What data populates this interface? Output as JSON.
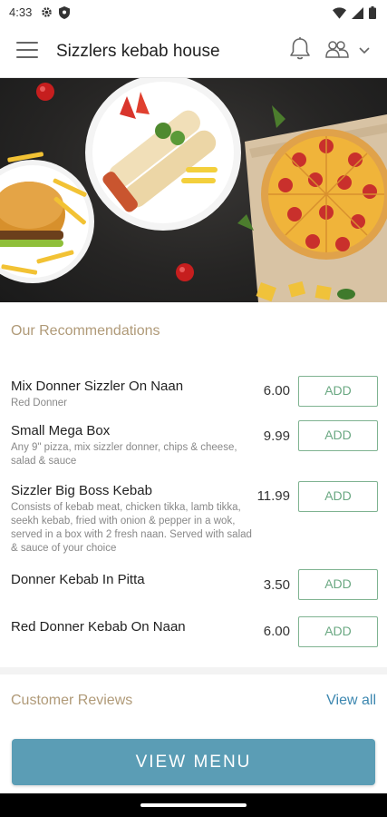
{
  "status_bar": {
    "time": "4:33",
    "left_icons": [
      "settings-icon",
      "shield-icon"
    ],
    "right_icons": [
      "wifi-icon",
      "signal-icon",
      "battery-icon"
    ]
  },
  "app_bar": {
    "title": "Sizzlers kebab house",
    "icons": [
      "menu-icon",
      "bell-icon",
      "users-icon",
      "chevron-down-icon"
    ]
  },
  "recommendations": {
    "title": "Our Recommendations",
    "items": [
      {
        "name": "Mix Donner Sizzler On Naan",
        "desc": "Red Donner",
        "price": "6.00",
        "button": "ADD"
      },
      {
        "name": "Small Mega Box",
        "desc": "Any 9\" pizza, mix sizzler donner, chips & cheese, salad & sauce",
        "price": "9.99",
        "button": "ADD"
      },
      {
        "name": "Sizzler Big Boss Kebab",
        "desc": "Consists of kebab meat, chicken tikka, lamb tikka, seekh kebab, fried with onion & pepper in a wok, served in a box with 2 fresh naan. Served with salad & sauce of your choice",
        "price": "11.99",
        "button": "ADD"
      },
      {
        "name": "Donner Kebab In Pitta",
        "desc": "",
        "price": "3.50",
        "button": "ADD"
      },
      {
        "name": "Red Donner Kebab On Naan",
        "desc": "",
        "price": "6.00",
        "button": "ADD"
      }
    ]
  },
  "reviews": {
    "title": "Customer Reviews",
    "view_all": "View all"
  },
  "footer": {
    "view_menu": "VIEW MENU"
  },
  "colors": {
    "accent_blue": "#5b9db5",
    "add_green": "#6aa882",
    "section_title": "#b09a78",
    "link_blue": "#3c87b0"
  }
}
